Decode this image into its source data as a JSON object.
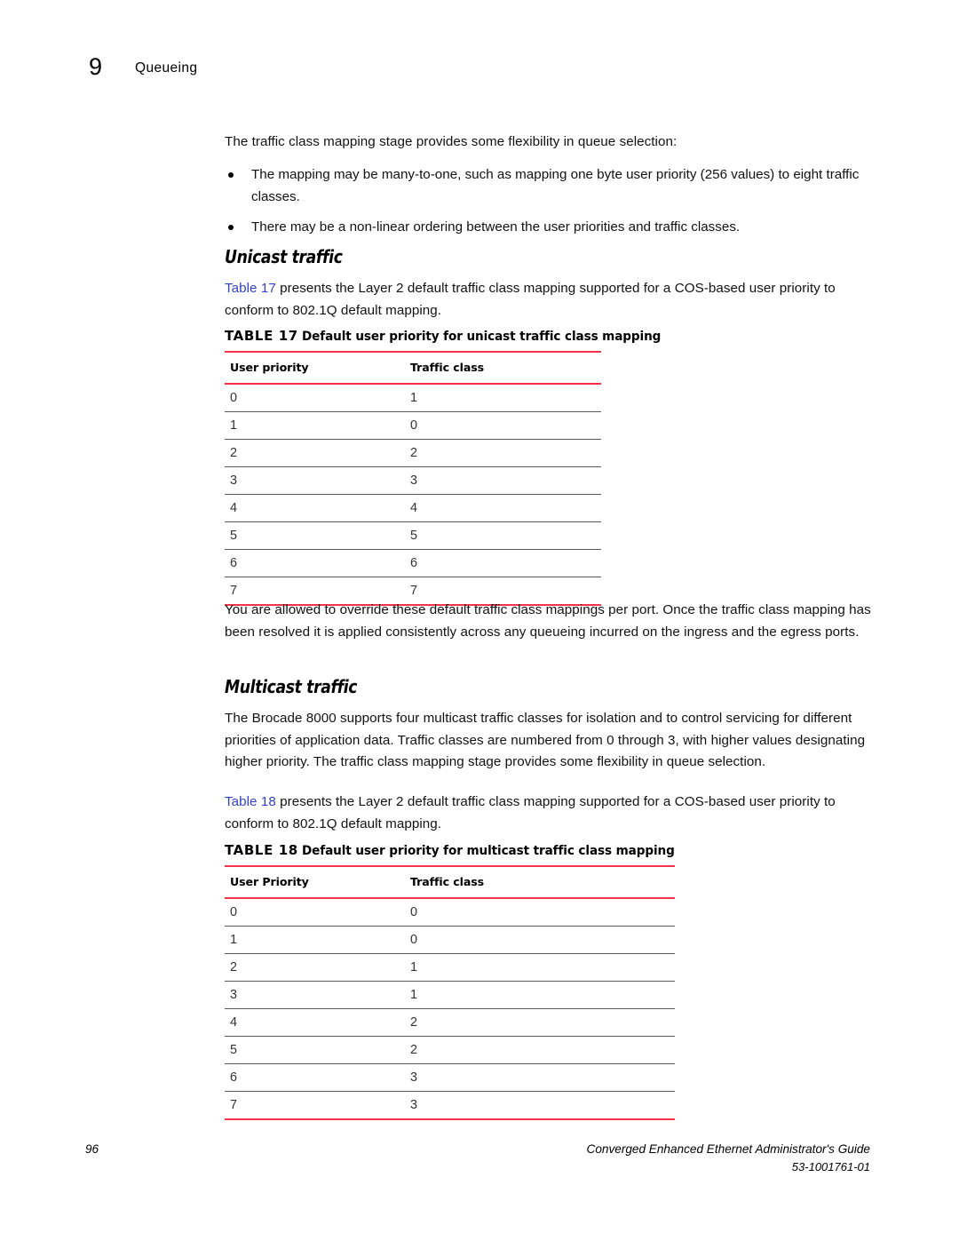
{
  "header": {
    "chapter_number": "9",
    "chapter_title": "Queueing"
  },
  "intro": {
    "lead": "The traffic class mapping stage provides some flexibility in queue selection:",
    "bullets": [
      "The mapping may be many-to-one, such as mapping one byte user priority (256 values) to eight traffic classes.",
      "There may be a non-linear ordering between the user priorities and traffic classes."
    ]
  },
  "unicast": {
    "heading": "Unicast traffic",
    "intro_link": "Table 17",
    "intro_rest": " presents the Layer 2 default traffic class mapping supported for a COS-based user priority to conform to 802.1Q default mapping."
  },
  "table17": {
    "label": "TABLE 17",
    "title": "Default user priority for unicast traffic class mapping",
    "columns": [
      "User priority",
      "Traffic class"
    ],
    "rows": [
      [
        "0",
        "1"
      ],
      [
        "1",
        "0"
      ],
      [
        "2",
        "2"
      ],
      [
        "3",
        "3"
      ],
      [
        "4",
        "4"
      ],
      [
        "5",
        "5"
      ],
      [
        "6",
        "6"
      ],
      [
        "7",
        "7"
      ]
    ]
  },
  "override_paragraph": "You are allowed to override these default traffic class mappings per port. Once the traffic class mapping has been resolved it is applied consistently across any queueing incurred on the ingress and the egress ports.",
  "multicast": {
    "heading": "Multicast traffic",
    "paragraph": "The Brocade 8000 supports four multicast traffic classes for isolation and to control servicing for different priorities of application data. Traffic classes are numbered from 0 through 3, with higher values designating higher priority. The traffic class mapping stage provides some flexibility in queue selection.",
    "intro_link": "Table 18",
    "intro_rest": " presents the Layer 2 default traffic class mapping supported for a COS-based user priority to conform to 802.1Q default mapping."
  },
  "table18": {
    "label": "TABLE 18",
    "title": "Default user priority for multicast traffic class mapping",
    "columns": [
      "User Priority",
      "Traffic class"
    ],
    "rows": [
      [
        "0",
        "0"
      ],
      [
        "1",
        "0"
      ],
      [
        "2",
        "1"
      ],
      [
        "3",
        "1"
      ],
      [
        "4",
        "2"
      ],
      [
        "5",
        "2"
      ],
      [
        "6",
        "3"
      ],
      [
        "7",
        "3"
      ]
    ]
  },
  "footer": {
    "page_number": "96",
    "document_title": "Converged Enhanced Ethernet Administrator's Guide",
    "document_number": "53-1001761-01"
  },
  "colors": {
    "rule_red": "#f4334a",
    "link_blue": "#3344cc",
    "row_rule_gray": "#5a5a5a"
  }
}
